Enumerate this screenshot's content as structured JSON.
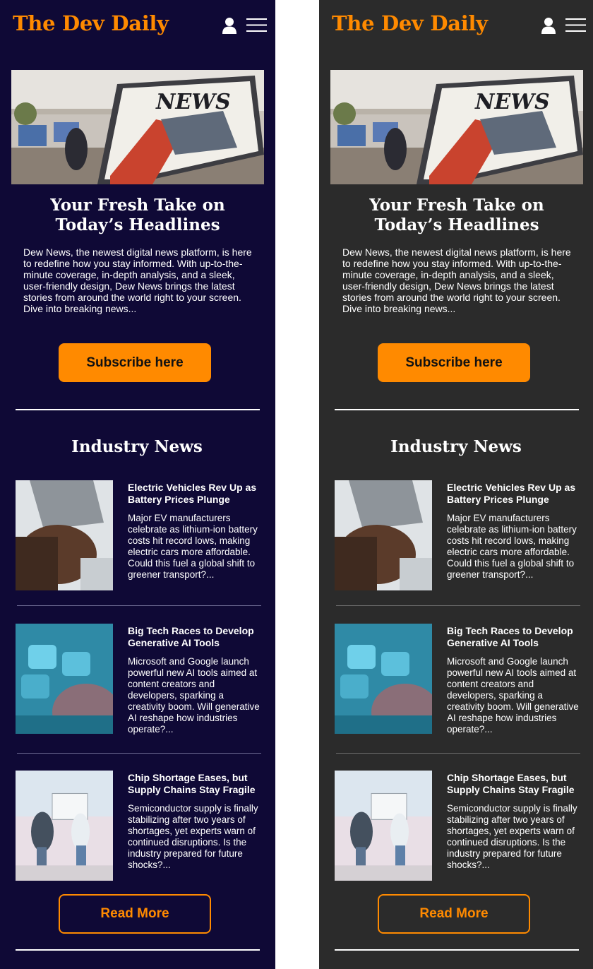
{
  "brand": "The Dev Daily",
  "icons": {
    "account": "user-icon",
    "menu": "hamburger-menu-icon"
  },
  "hero": {
    "image_label": "NEWS",
    "title": "Your Fresh Take on Today’s Headlines",
    "text": "Dew News, the newest digital news platform, is here to redefine how you stay informed. With up-to-the-minute coverage, in-depth analysis, and a sleek, user-friendly design, Dew News brings the latest stories from around the world right to your screen. Dive into breaking news...",
    "subscribe_label": "Subscribe here"
  },
  "industry": {
    "title": "Industry News",
    "articles": [
      {
        "title": "Electric Vehicles Rev Up as Battery Prices Plunge",
        "summary": "Major EV manufacturers celebrate as lithium-ion battery costs hit record lows, making electric cars more affordable. Could this fuel a global shift to greener transport?..."
      },
      {
        "title": "Big Tech Races to Develop Generative AI Tools",
        "summary": "Microsoft and Google launch powerful new AI tools aimed at content creators and developers, sparking a creativity boom. Will generative AI reshape how industries operate?..."
      },
      {
        "title": "Chip Shortage Eases, but Supply Chains Stay Fragile",
        "summary": "Semiconductor supply is finally stabilizing after two years of shortages, yet experts warn of continued disruptions. Is the industry prepared for future shocks?..."
      }
    ],
    "read_more_label": "Read More"
  },
  "colors": {
    "accent": "#ff8a00",
    "panel_dark_bg": "#0f0936",
    "panel_gray_bg": "#2b2b2b",
    "text": "#ffffff"
  }
}
